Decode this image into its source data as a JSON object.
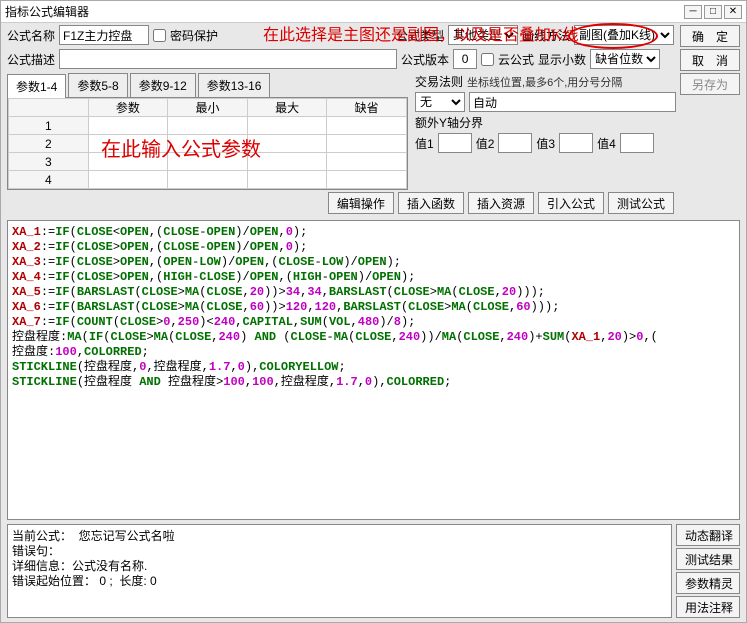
{
  "title": "指标公式编辑器",
  "row1": {
    "name_label": "公式名称",
    "name_value": "F1Z主力控盘",
    "pwd_label": "密码保护",
    "type_label": "公式类型",
    "type_value": "其他类型",
    "draw_label": "画线方法",
    "draw_value": "副图(叠加K线)",
    "ok": "确　定"
  },
  "row2": {
    "desc_label": "公式描述",
    "ver_label": "公式版本",
    "ver_value": "0",
    "cloud_label": "云公式",
    "dec_label": "显示小数",
    "dec_value": "缺省位数",
    "cancel": "取　消"
  },
  "tabs": [
    "参数1-4",
    "参数5-8",
    "参数9-12",
    "参数13-16"
  ],
  "param_headers": {
    "r": "",
    "c1": "参数",
    "c2": "最小",
    "c3": "最大",
    "c4": "缺省"
  },
  "rows": [
    "1",
    "2",
    "3",
    "4"
  ],
  "right": {
    "rule_label": "交易法则",
    "rule_hint": "坐标线位置,最多6个,用分号分隔",
    "saveas": "另存为",
    "chart_type": "无",
    "auto": "自动",
    "extY": "额外Y轴分界",
    "v1": "值1",
    "v2": "值2",
    "v3": "值3",
    "v4": "值4"
  },
  "toolbar": {
    "b1": "编辑操作",
    "b2": "插入函数",
    "b3": "插入资源",
    "b4": "引入公式",
    "b5": "测试公式"
  },
  "bottom_msg": "当前公式：  您忘记写公式名啦\n错误句：\n详细信息：公式没有名称.\n错误起始位置： 0 ;  长度: 0",
  "rbtns": {
    "b1": "动态翻译",
    "b2": "测试结果",
    "b3": "参数精灵",
    "b4": "用法注释"
  },
  "annot": {
    "top": "在此选择是主图还是副图，以及是否叠加K线",
    "param": "在此输入公式参数"
  }
}
